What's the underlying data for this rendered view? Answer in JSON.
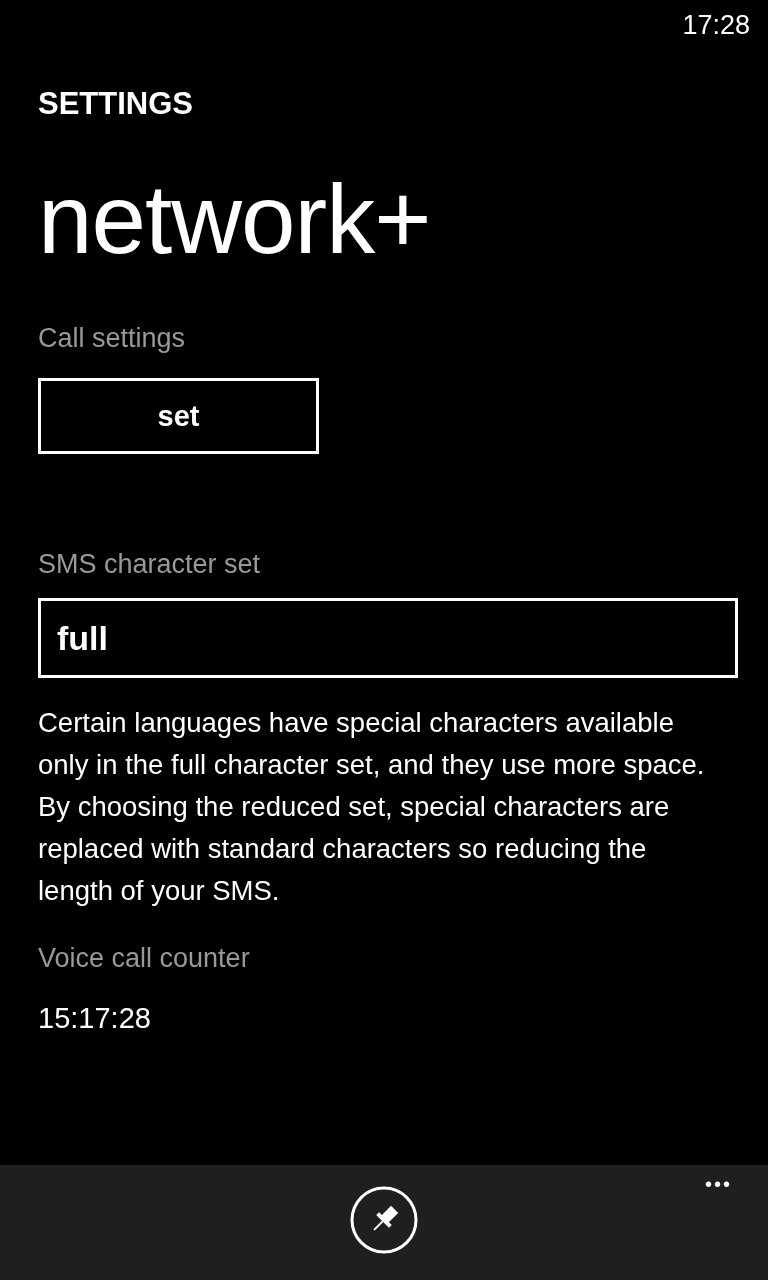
{
  "status_bar": {
    "time": "17:28"
  },
  "header": {
    "app_title": "SETTINGS",
    "page_title": "network+"
  },
  "sections": [
    {
      "kind": "button",
      "label": "Call settings",
      "button": "set"
    },
    {
      "kind": "picker",
      "label": "SMS character set",
      "value": "full",
      "description": "Certain languages have special characters available only in the full character set, and they use more space. By choosing the reduced set, special characters are replaced with standard characters so reducing the length of your SMS."
    },
    {
      "kind": "text",
      "label": "Voice call counter",
      "value": "15:17:28"
    }
  ],
  "app_bar": {
    "more": "•••"
  }
}
